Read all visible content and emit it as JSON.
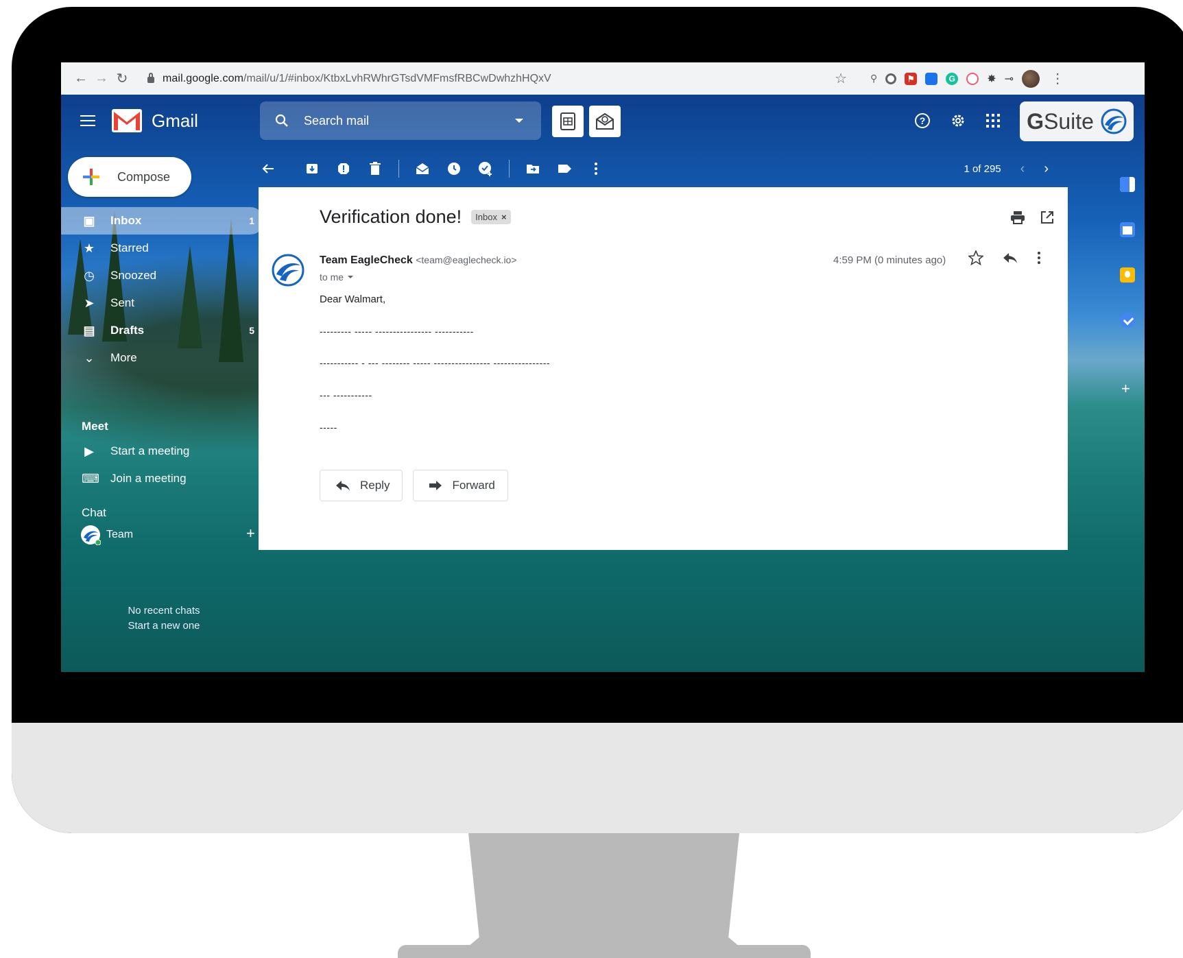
{
  "browser": {
    "url_domain": "mail.google.com",
    "url_path": "/mail/u/1/#inbox/KtbxLvhRWhrGTsdVMFmsfRBCwDwhzhHQxV"
  },
  "gmail": {
    "brand": "Gmail",
    "search_placeholder": "Search mail",
    "gsuite_label_g": "G",
    "gsuite_label_rest": " Suite",
    "compose_label": "Compose",
    "nav": [
      {
        "label": "Inbox",
        "count": "1",
        "icon": "inbox-icon"
      },
      {
        "label": "Starred",
        "count": "",
        "icon": "star-icon"
      },
      {
        "label": "Snoozed",
        "count": "",
        "icon": "clock-icon"
      },
      {
        "label": "Sent",
        "count": "",
        "icon": "send-icon"
      },
      {
        "label": "Drafts",
        "count": "5",
        "icon": "draft-icon"
      },
      {
        "label": "More",
        "count": "",
        "icon": "chevron-down-icon"
      }
    ],
    "meet": {
      "heading": "Meet",
      "start": "Start a meeting",
      "join": "Join a meeting"
    },
    "chat": {
      "heading": "Chat",
      "contact": "Team",
      "no_recent": "No recent chats",
      "start_new": "Start a new one"
    },
    "pager": "1 of 295"
  },
  "message": {
    "subject": "Verification done!",
    "label_chip": "Inbox",
    "sender_name": "Team EagleCheck",
    "sender_email": "<team@eaglecheck.io>",
    "to": "to me",
    "time": "4:59 PM (0 minutes ago)",
    "greeting": "Dear Walmart,",
    "lines": [
      "--------- ----- ---------------- -----------",
      "----------- - ---    -------- ----- ---------------- ----------------",
      "--- -----------",
      "-----"
    ],
    "reply_label": "Reply",
    "forward_label": "Forward"
  },
  "colors": {
    "gmail_red": "#ea4335",
    "eagle_blue": "#1565c0"
  }
}
